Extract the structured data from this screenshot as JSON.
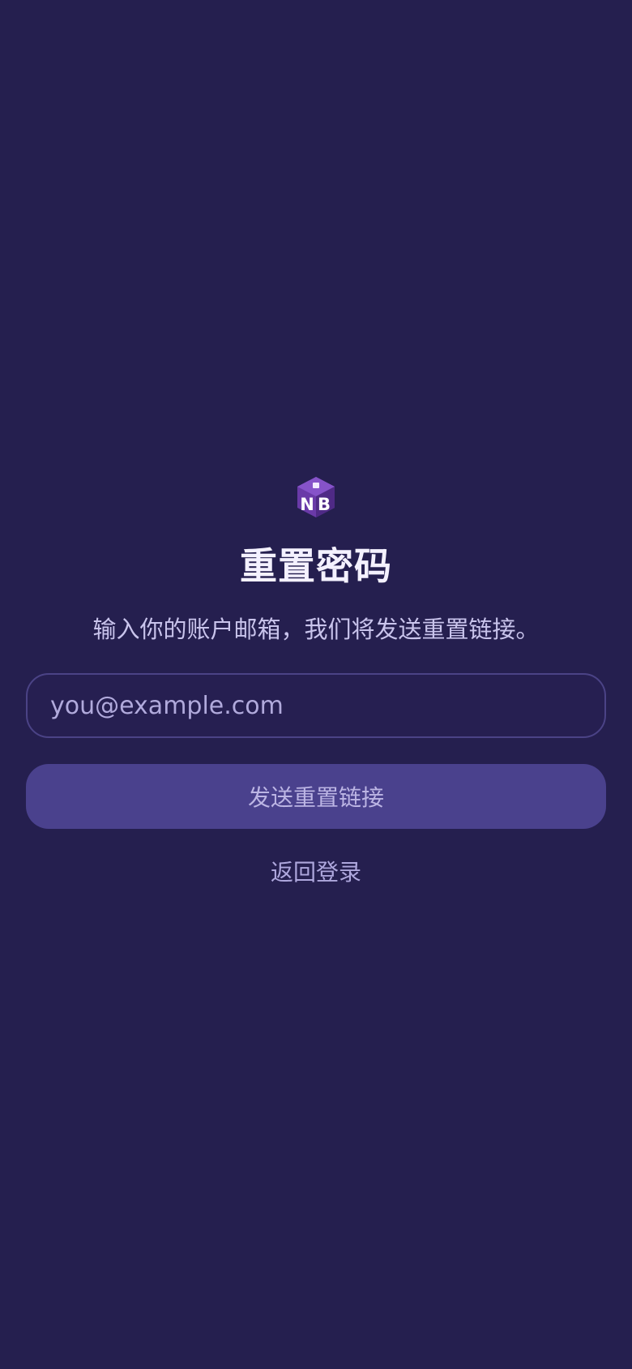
{
  "app": {
    "logo_icon": "nb-cube-logo-icon",
    "brand_color": "#6a3aa8"
  },
  "reset": {
    "title": "重置密码",
    "subtitle": "输入你的账户邮箱，我们将发送重置链接。",
    "email_placeholder": "you@example.com",
    "email_value": "",
    "submit_label": "发送重置链接",
    "back_label": "返回登录"
  },
  "colors": {
    "background": "#251f4f",
    "input_border": "#4b4386",
    "button_bg": "#4a418d",
    "muted_text": "#aea7dd"
  }
}
